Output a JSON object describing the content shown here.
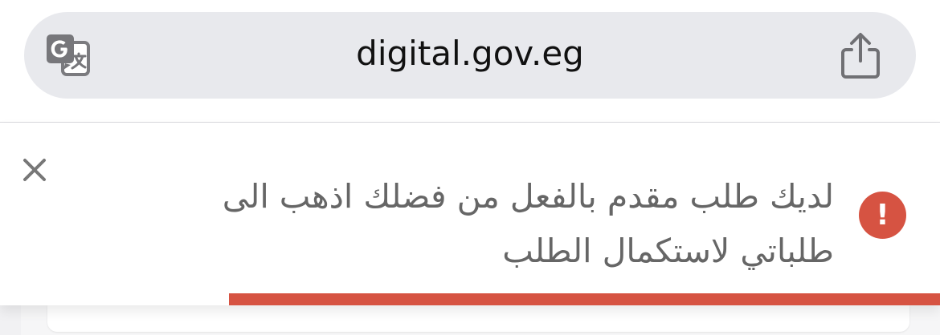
{
  "browser": {
    "url": "digital.gov.eg",
    "translate_icon": "translate-icon",
    "share_icon": "share-icon"
  },
  "notification": {
    "close_icon": "close-icon",
    "status_icon": "error-icon",
    "status_symbol": "!",
    "lines": [
      "لديك طلب مقدم بالفعل من فضلك اذهب الى",
      "طلباتي لاستكمال الطلب"
    ],
    "progress_fraction": 0.756,
    "accent_color": "#d65342",
    "text_color": "#666666"
  },
  "colors": {
    "address_bar": "#e8e9ed",
    "page_background": "#ffffff"
  }
}
